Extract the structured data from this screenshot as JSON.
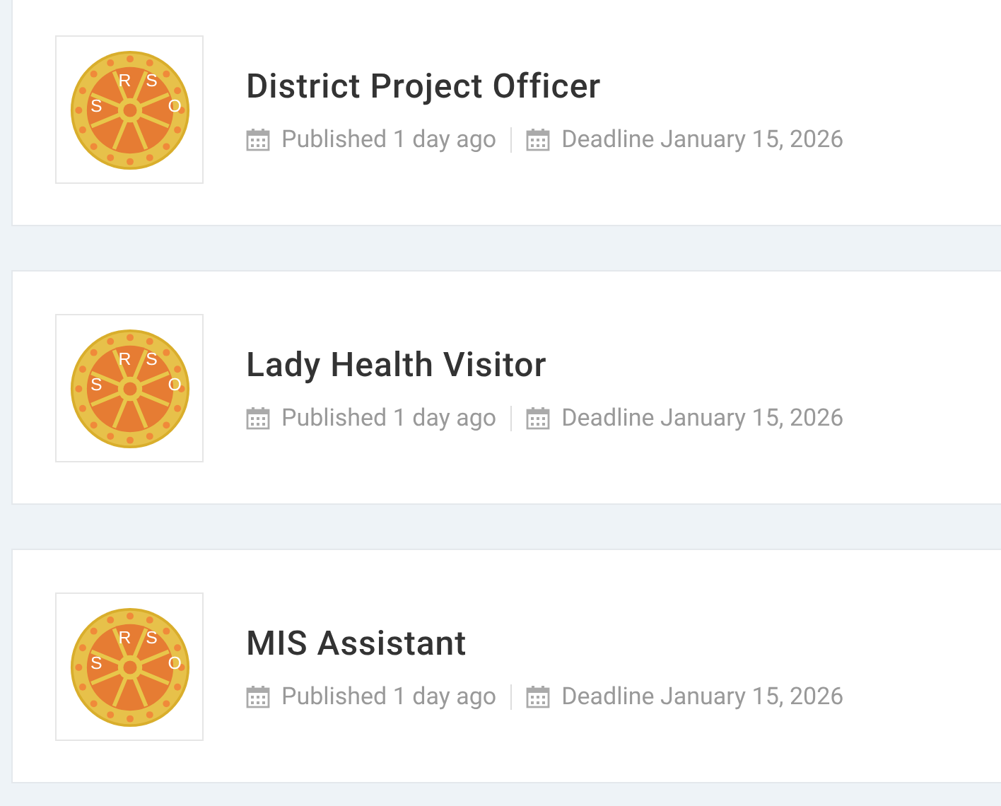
{
  "jobs": [
    {
      "title": "District Project Officer",
      "logo_letters": [
        "S",
        "R",
        "S",
        "O"
      ],
      "published": "Published 1 day ago",
      "deadline": "Deadline January 15, 2026"
    },
    {
      "title": "Lady Health Visitor",
      "logo_letters": [
        "S",
        "R",
        "S",
        "O"
      ],
      "published": "Published 1 day ago",
      "deadline": "Deadline January 15, 2026"
    },
    {
      "title": "MIS Assistant",
      "logo_letters": [
        "S",
        "R",
        "S",
        "O"
      ],
      "published": "Published 1 day ago",
      "deadline": "Deadline January 15, 2026"
    }
  ]
}
